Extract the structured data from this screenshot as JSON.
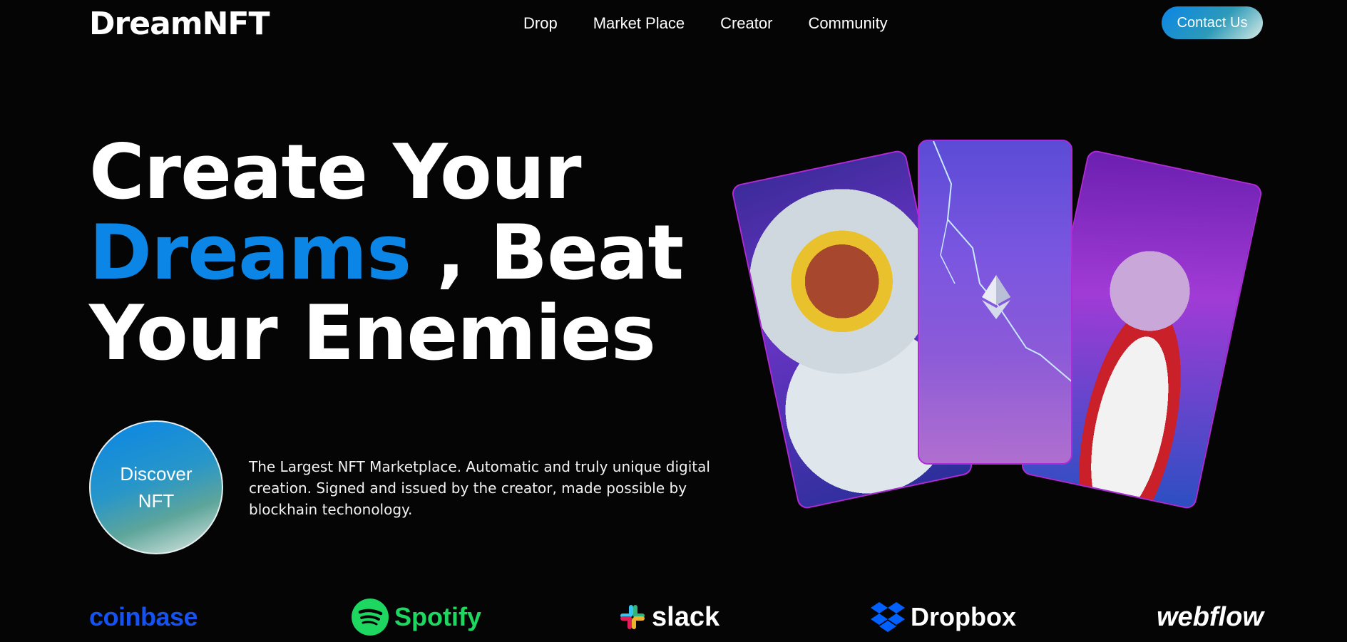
{
  "nav": {
    "logo": "DreamNFT",
    "items": [
      {
        "label": "Drop"
      },
      {
        "label": "Market Place"
      },
      {
        "label": "Creator"
      },
      {
        "label": "Community"
      }
    ],
    "contact_label": "Contact Us"
  },
  "hero": {
    "line1": "Create Your",
    "line2_accent": "Dreams",
    "line2_rest": " , Beat",
    "line3": "Your Enemies",
    "accent_color": "#0b86e6",
    "discover_label": "Discover NFT",
    "description": "The Largest NFT Marketplace. Automatic and truly unique digital creation. Signed and issued by the creator, made possible by blockhain techonology."
  },
  "cards": [
    {
      "name": "astronaut-zombie-card"
    },
    {
      "name": "ethereum-lightning-card"
    },
    {
      "name": "basketball-zombie-card"
    }
  ],
  "brands": {
    "coinbase": "coinbase",
    "spotify": "Spotify",
    "slack": "slack",
    "dropbox": "Dropbox",
    "webflow": "webflow"
  }
}
